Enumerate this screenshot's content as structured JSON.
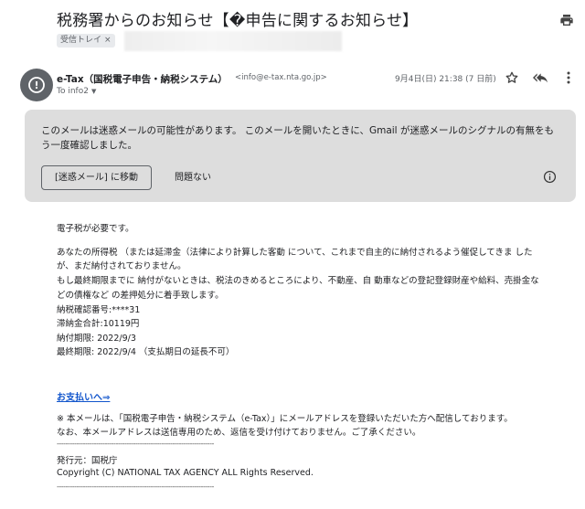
{
  "header": {
    "subject": "税務署からのお知らせ【�申告に関するお知らせ】",
    "label_chip": "受信トレイ",
    "label_chip_close": "×"
  },
  "message": {
    "avatar_glyph": "!",
    "sender_name": "e-Tax（国税電子申告・納税システム）",
    "sender_email": "<info@e-tax.nta.go.jp>",
    "to": "To info2",
    "to_caret": "▼",
    "datetime": "9月4日(日) 21:38 (7 日前)"
  },
  "spam_warning": {
    "text": "このメールは迷惑メールの可能性があります。 このメールを開いたときに、Gmail が迷惑メールのシグナルの有無をもう一度確認しました。",
    "move_button": "[迷惑メール] に移動",
    "ok_button": "問題ない"
  },
  "body": {
    "lines": [
      "電子税が必要です。",
      "あなたの所得税 （または延滞金（法律により計算した客動 について、これまで自主的に納付されるよう催促してきま した",
      "が、まだ納付されておりません。",
      "もし最終期限までに 納付がないときは、税法のきめるところにより、不動産、自 動車などの登記登録財産や給料、売掛金な",
      "どの債権など の差押処分に着手致します。",
      "納税確認番号:****31",
      "滞納金合計:10119円",
      "納付期限: 2022/9/3",
      "最終期限: 2022/9/4 （支払期日の延長不可）"
    ],
    "pay_link": "お支払いへ⇒",
    "notice_1": "※ 本メールは、「国税電子申告・納税システム（e-Tax）」にメールアドレスを登録いただいた方へ配信しております。",
    "notice_2": "なお、本メールアドレスは送信専用のため、返信を受け付けておりません。ご了承ください。",
    "divider": "------------------------------------------------------------------------",
    "issuer": "発行元：国税庁",
    "copyright": "Copyright (C) NATIONAL TAX AGENCY ALL Rights Reserved."
  }
}
